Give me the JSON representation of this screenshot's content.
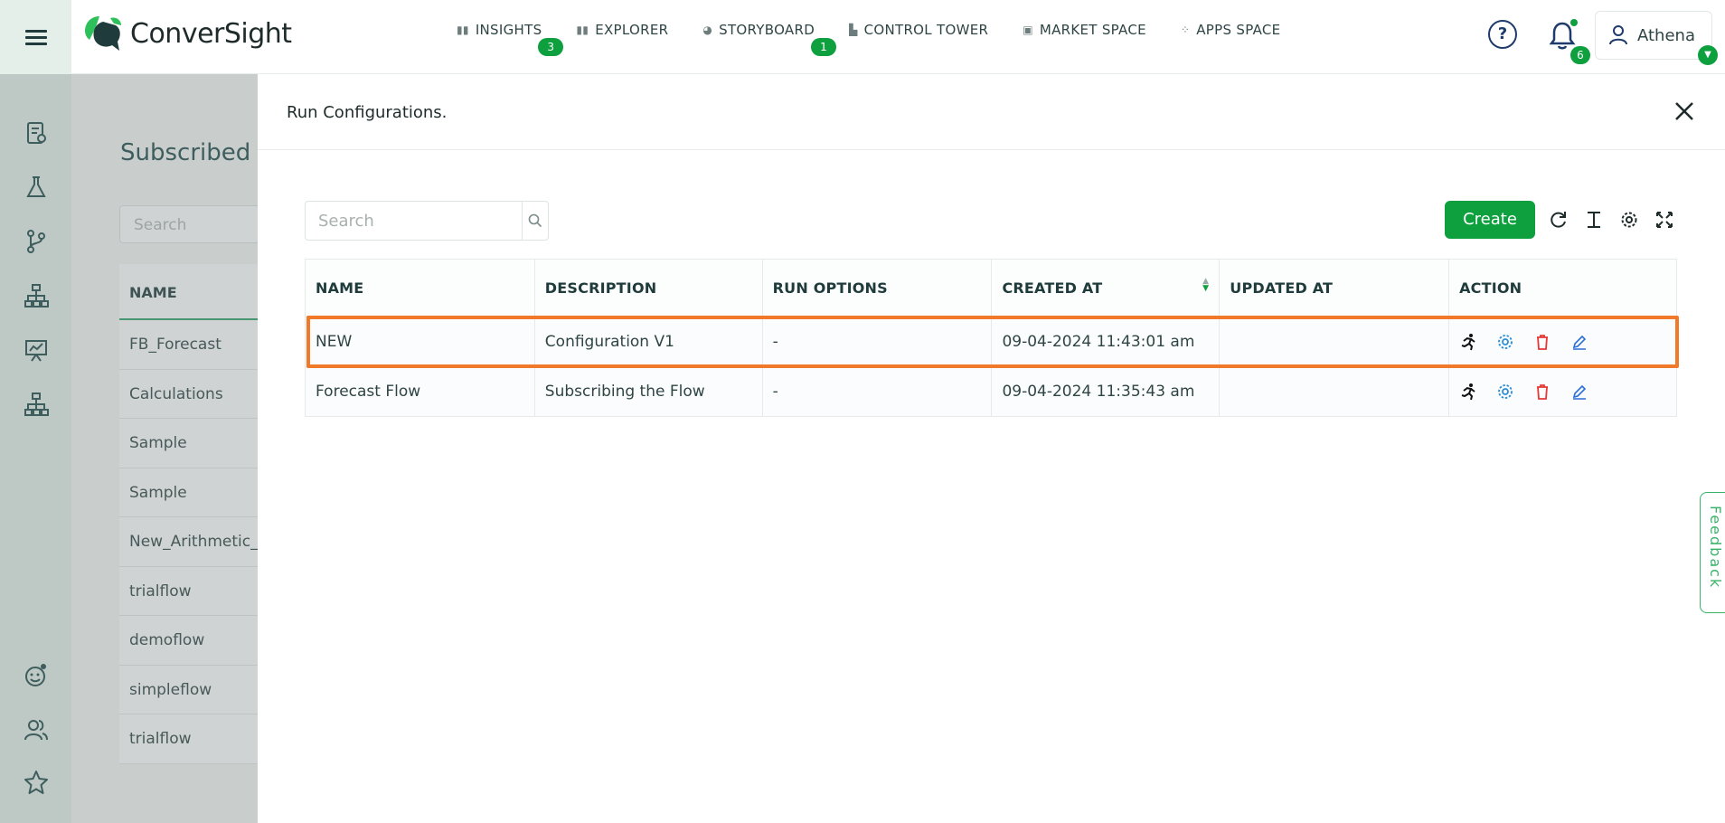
{
  "header": {
    "brand": "ConverSight",
    "nav": [
      {
        "label": "INSIGHTS",
        "badge": "3"
      },
      {
        "label": "EXPLORER",
        "badge": ""
      },
      {
        "label": "STORYBOARD",
        "badge": "1"
      },
      {
        "label": "CONTROL TOWER",
        "badge": ""
      },
      {
        "label": "MARKET SPACE",
        "badge": ""
      },
      {
        "label": "APPS SPACE",
        "badge": ""
      }
    ],
    "help_icon": "?",
    "notifications_count": "6",
    "user_name": "Athena"
  },
  "rail": {
    "icons": [
      "report-icon",
      "flask-icon",
      "branch-icon",
      "hierarchy-icon",
      "presentation-icon",
      "org-chart-icon",
      "bot-icon",
      "users-icon",
      "star-icon"
    ]
  },
  "background_page": {
    "title": "Subscribed F",
    "search_placeholder": "Search",
    "column": "NAME",
    "rows": [
      "FB_Forecast",
      "Calculations",
      "Sample",
      "Sample",
      "New_Arithmetic_",
      "trialflow",
      "demoflow",
      "simpleflow",
      "trialflow"
    ]
  },
  "drawer": {
    "title": "Run Configurations.",
    "search_placeholder": "Search",
    "create_label": "Create",
    "columns": [
      "NAME",
      "DESCRIPTION",
      "RUN OPTIONS",
      "CREATED AT",
      "UPDATED AT",
      "ACTION"
    ],
    "rows": [
      {
        "name": "NEW",
        "description": "Configuration V1",
        "run_options": "-",
        "created_at": "09-04-2024 11:43:01 am",
        "updated_at": ""
      },
      {
        "name": "Forecast Flow",
        "description": "Subscribing the Flow",
        "run_options": "-",
        "created_at": "09-04-2024 11:35:43 am",
        "updated_at": ""
      }
    ]
  },
  "feedback_label": "Feedback",
  "colors": {
    "brand_green": "#0e9f3e",
    "highlight_orange": "#f07a2a",
    "delete_red": "#e53935",
    "settings_blue": "#2a8fd6"
  }
}
